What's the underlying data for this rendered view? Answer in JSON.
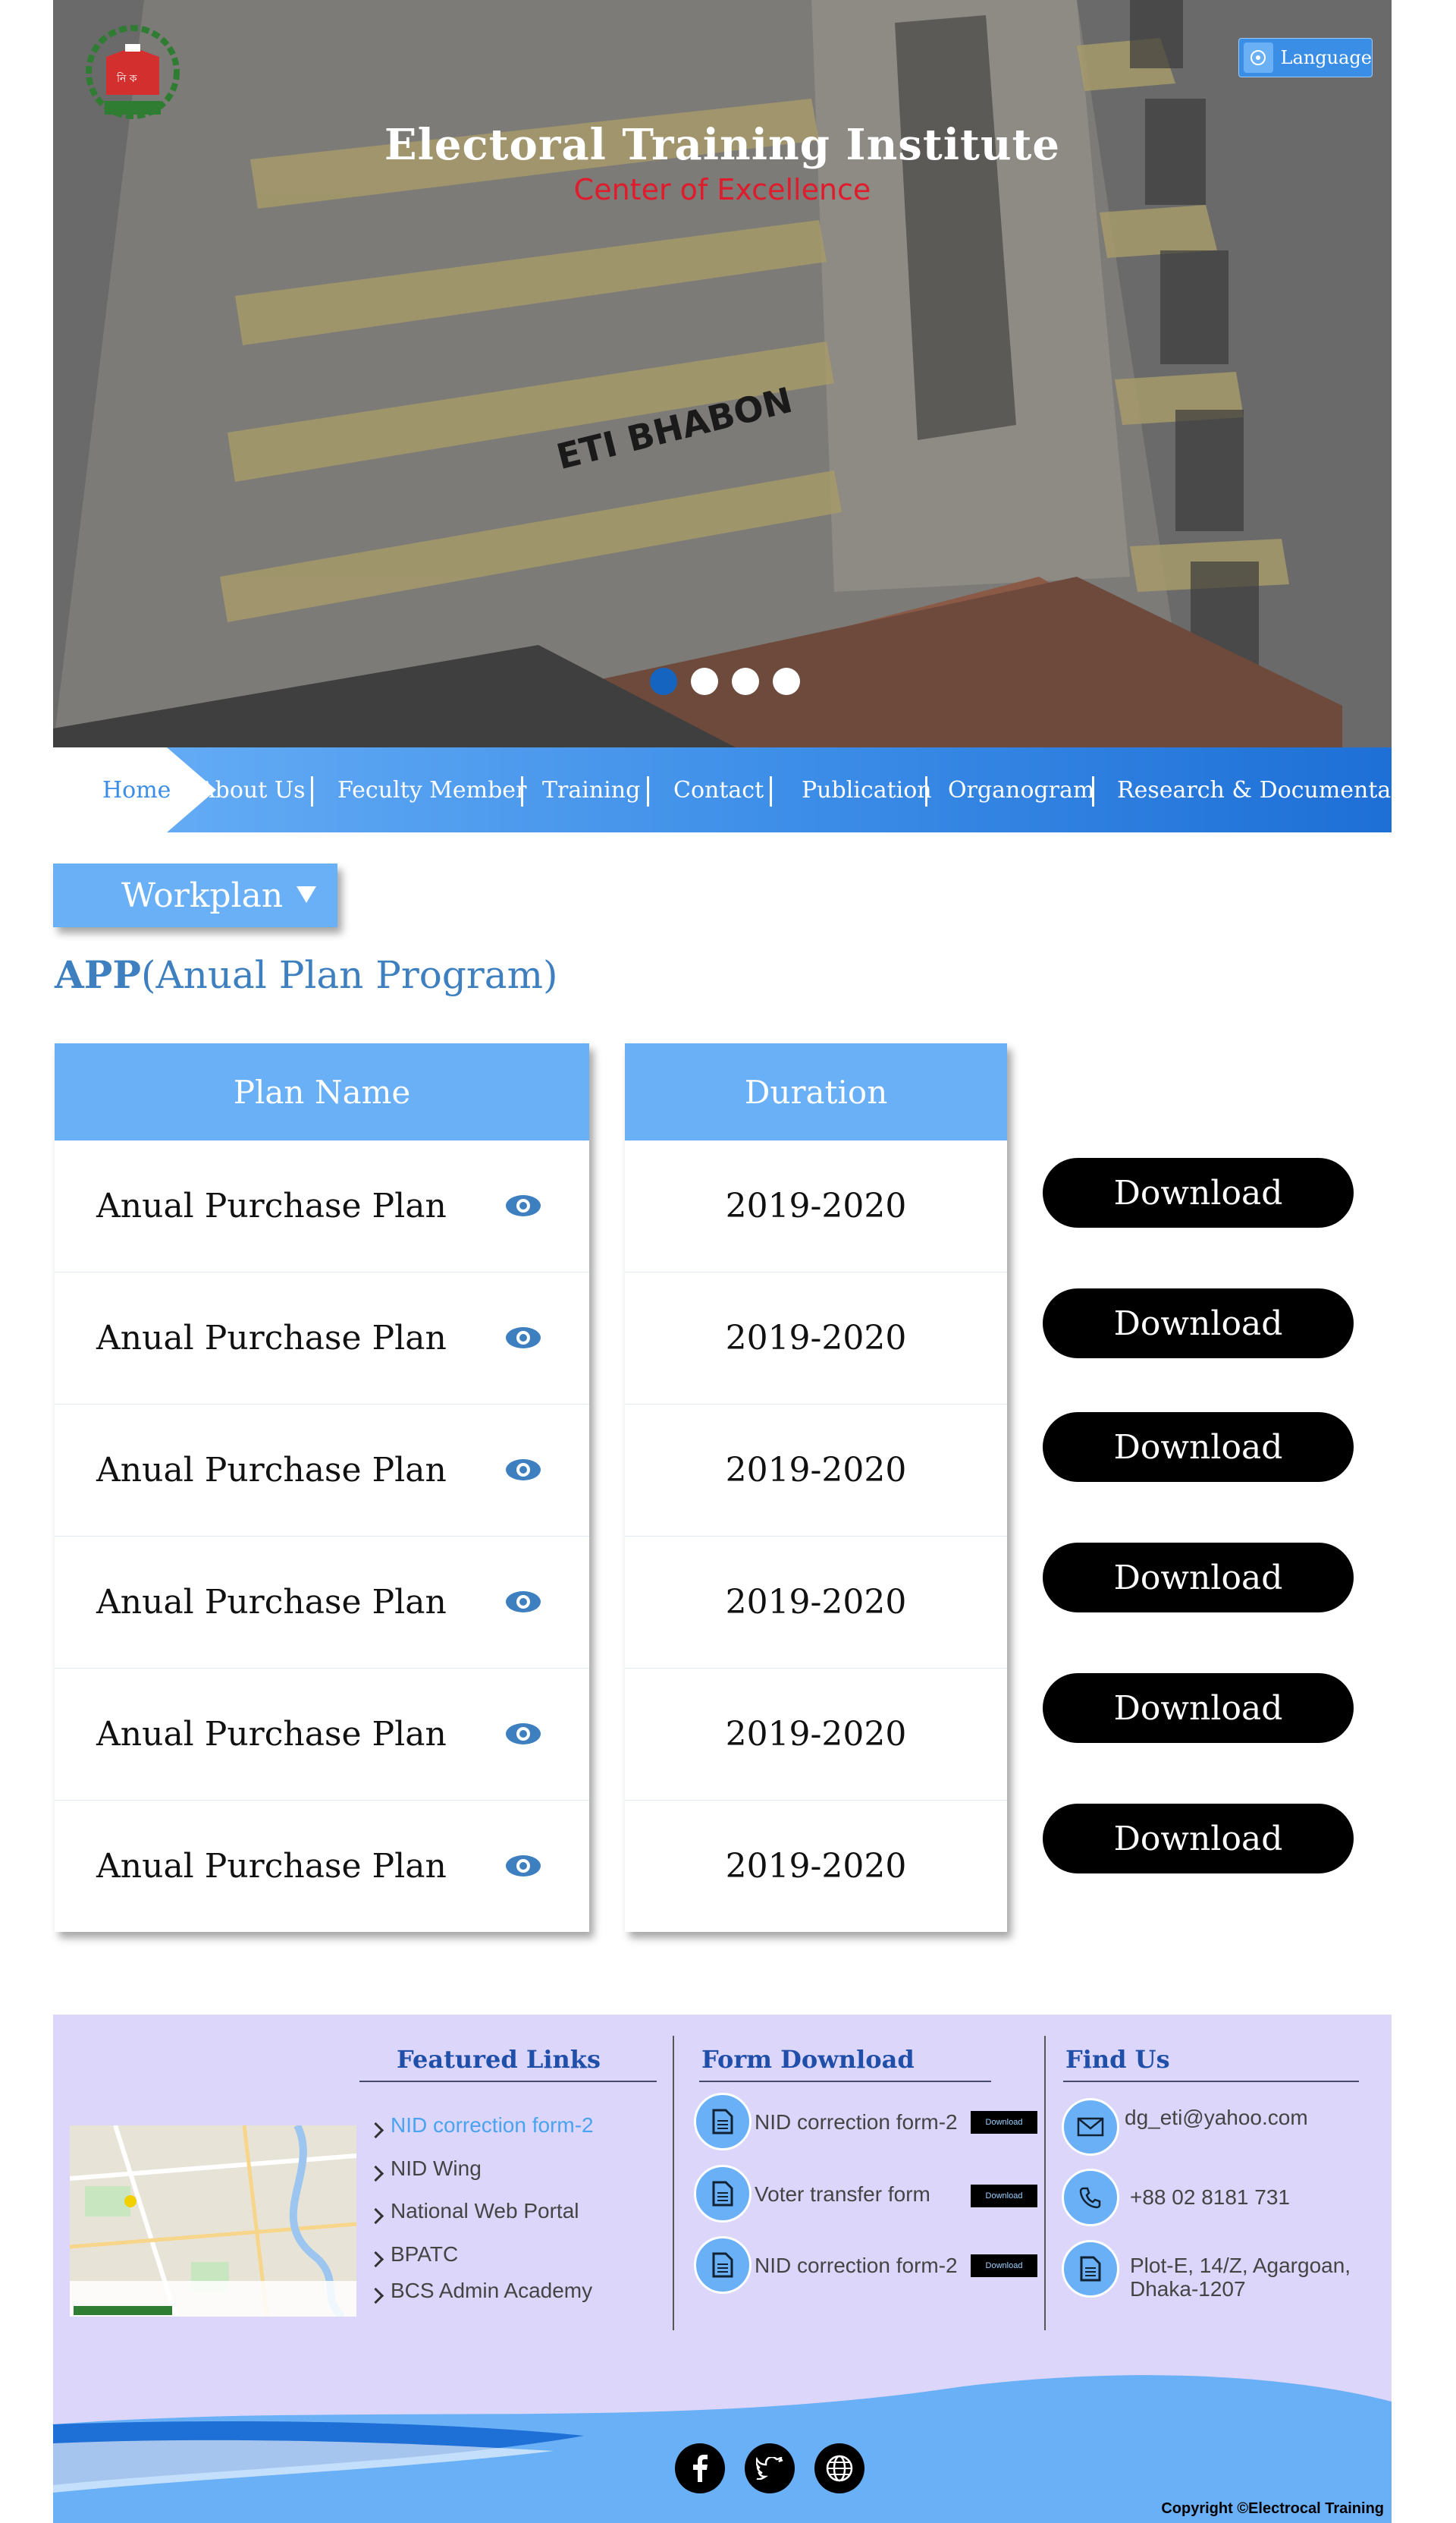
{
  "header": {
    "language_label": "Language",
    "title": "Electoral Training Institute",
    "subtitle": "Center of Excellence",
    "building_sign": "ETI BHABON",
    "slides": 4,
    "active_slide": 1
  },
  "nav": {
    "items": [
      {
        "label": "Home",
        "active": true
      },
      {
        "label": "About Us"
      },
      {
        "label": "Feculty Member"
      },
      {
        "label": "Training"
      },
      {
        "label": "Contact"
      },
      {
        "label": "Publication"
      },
      {
        "label": "Organogram"
      },
      {
        "label": "Research & Documentation"
      }
    ]
  },
  "workplan": {
    "label": "Workplan"
  },
  "app_heading": {
    "bold": "APP",
    "rest": "(Anual Plan Program)"
  },
  "table": {
    "plan_header": "Plan Name",
    "duration_header": "Duration",
    "rows": [
      {
        "plan": "Anual Purchase Plan",
        "duration": "2019-2020",
        "download": "Download"
      },
      {
        "plan": "Anual Purchase Plan",
        "duration": "2019-2020",
        "download": "Download"
      },
      {
        "plan": "Anual Purchase Plan",
        "duration": "2019-2020",
        "download": "Download"
      },
      {
        "plan": "Anual Purchase Plan",
        "duration": "2019-2020",
        "download": "Download"
      },
      {
        "plan": "Anual Purchase Plan",
        "duration": "2019-2020",
        "download": "Download"
      },
      {
        "plan": "Anual Purchase Plan",
        "duration": "2019-2020",
        "download": "Download"
      }
    ]
  },
  "footer": {
    "featured_links": {
      "title": "Featured Links",
      "items": [
        "NID correction form-2",
        "NID Wing",
        "National Web Portal",
        "BPATC",
        "BCS Admin Academy"
      ]
    },
    "form_download": {
      "title": "Form Download",
      "items": [
        {
          "label": "NID correction form-2",
          "button": "Download"
        },
        {
          "label": "Voter transfer form",
          "button": "Download"
        },
        {
          "label": "NID correction form-2",
          "button": "Download"
        }
      ]
    },
    "find_us": {
      "title": "Find Us",
      "email": "dg_eti@yahoo.com",
      "phone": "+88 02 8181 731",
      "address_line1": "Plot-E, 14/Z, Agargoan,",
      "address_line2": "Dhaka-1207"
    },
    "copyright": "Copyright ©Electrocal Training"
  },
  "colors": {
    "accent": "#6ab0f7",
    "nav_dark": "#1e6fd6",
    "title_blue": "#3e7fbf",
    "footer_bg": "#dcd6fb",
    "subtitle_red": "#e01b2b"
  }
}
